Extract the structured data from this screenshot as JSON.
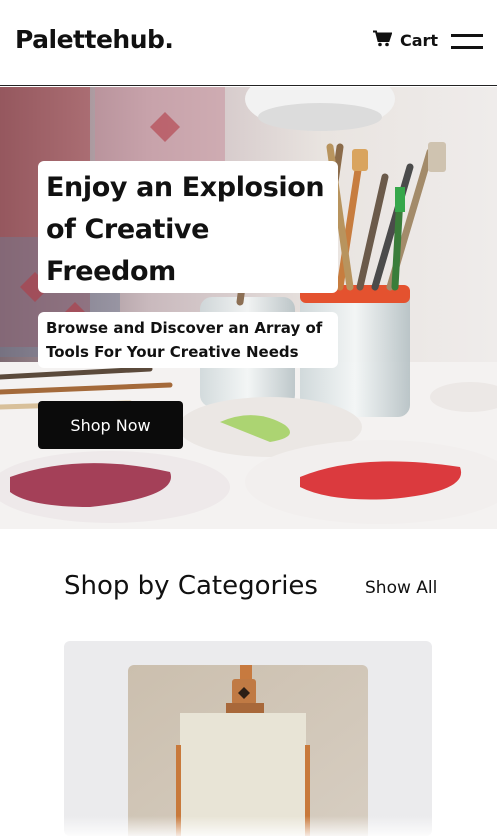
{
  "header": {
    "logo": "Palettehub.",
    "cart_label": "Cart",
    "icons": {
      "cart": "shopping-cart-icon",
      "menu": "hamburger-menu-icon"
    }
  },
  "hero": {
    "title": "Enjoy an Explosion of Creative Freedom",
    "subtitle": "Browse and Discover an Array of Tools For Your Creative Needs",
    "cta_label": "Shop Now"
  },
  "categories": {
    "heading": "Shop by Categories",
    "show_all_label": "Show All"
  },
  "colors": {
    "text": "#111111",
    "button_bg": "#0b0b0b",
    "card_bg": "#ebebed"
  }
}
